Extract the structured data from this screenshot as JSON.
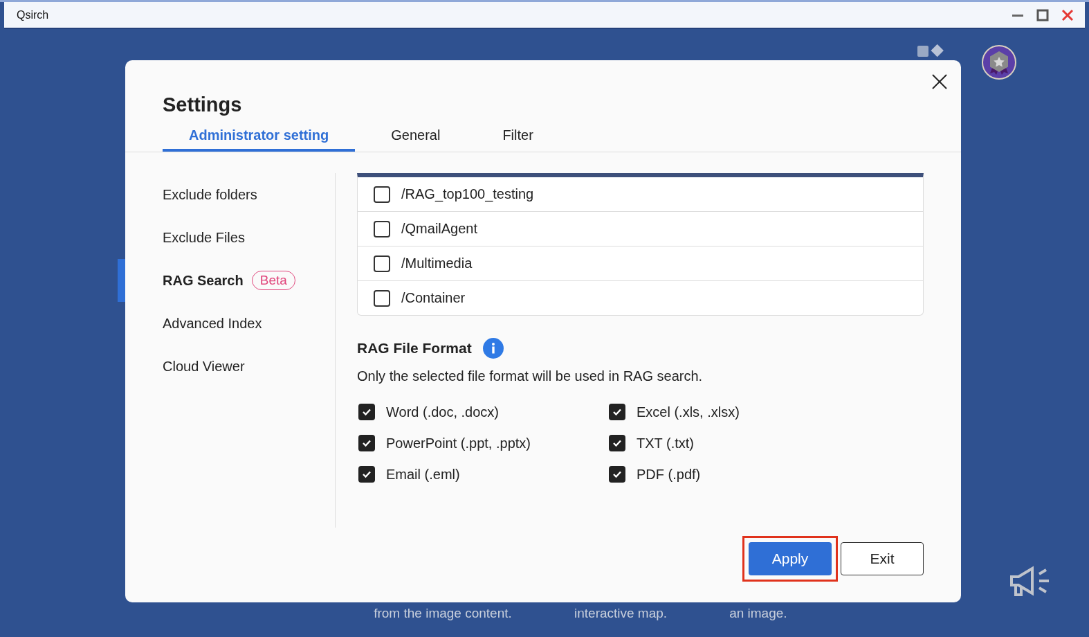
{
  "window": {
    "title": "Qsirch"
  },
  "background_captions": [
    {
      "text": "from the image content."
    },
    {
      "text": "interactive map."
    },
    {
      "text": "an image."
    }
  ],
  "dialog": {
    "title": "Settings",
    "tabs": [
      {
        "label": "Administrator setting",
        "selected": true
      },
      {
        "label": "General",
        "selected": false
      },
      {
        "label": "Filter",
        "selected": false
      }
    ],
    "sidebar": [
      {
        "label": "Exclude folders",
        "selected": false
      },
      {
        "label": "Exclude Files",
        "selected": false
      },
      {
        "label": "RAG Search",
        "badge": "Beta",
        "selected": true
      },
      {
        "label": "Advanced Index",
        "selected": false
      },
      {
        "label": "Cloud Viewer",
        "selected": false
      }
    ],
    "folders": [
      {
        "path": "/RAG_top100_testing",
        "checked": false
      },
      {
        "path": "/QmailAgent",
        "checked": false
      },
      {
        "path": "/Multimedia",
        "checked": false
      },
      {
        "path": "/Container",
        "checked": false
      }
    ],
    "format_section": {
      "title": "RAG File Format",
      "description": "Only the selected file format will be used in RAG search.",
      "formats": [
        {
          "label": "Word (.doc, .docx)",
          "checked": true
        },
        {
          "label": "Excel (.xls, .xlsx)",
          "checked": true
        },
        {
          "label": "PowerPoint (.ppt, .pptx)",
          "checked": true
        },
        {
          "label": "TXT (.txt)",
          "checked": true
        },
        {
          "label": "Email (.eml)",
          "checked": true
        },
        {
          "label": "PDF (.pdf)",
          "checked": true
        }
      ]
    },
    "buttons": [
      {
        "label": "Apply",
        "kind": "primary",
        "highlighted": true
      },
      {
        "label": "Exit",
        "kind": "secondary",
        "highlighted": false
      }
    ]
  }
}
